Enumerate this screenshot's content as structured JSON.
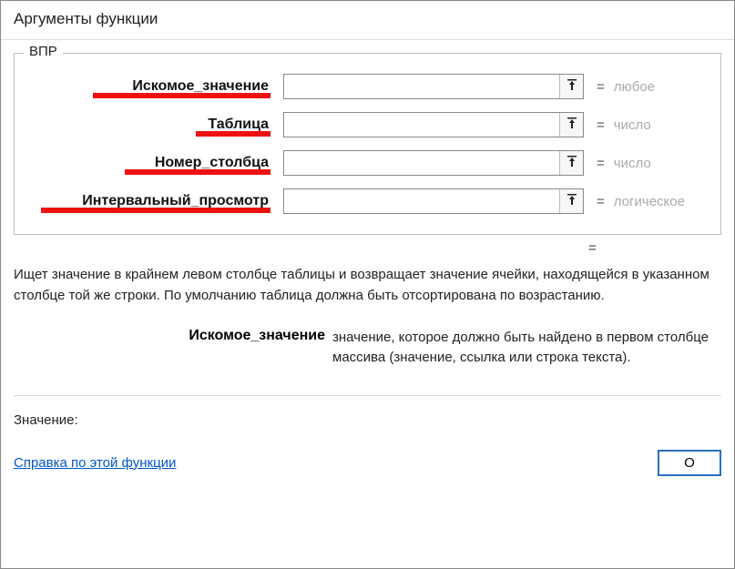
{
  "title": "Аргументы функции",
  "function_name": "ВПР",
  "args": [
    {
      "label": "Искомое_значение",
      "value": "",
      "type_hint": "любое",
      "underline_width": 195
    },
    {
      "label": "Таблица",
      "value": "",
      "type_hint": "число",
      "underline_width": 82
    },
    {
      "label": "Номер_столбца",
      "value": "",
      "type_hint": "число",
      "underline_width": 160
    },
    {
      "label": "Интервальный_просмотр",
      "value": "",
      "type_hint": "логическое",
      "underline_width": 252
    }
  ],
  "equals_sign": "=",
  "description": "Ищет значение в крайнем левом столбце таблицы и возвращает значение ячейки, находящейся в указанном столбце той же строки. По умолчанию таблица должна быть отсортирована по возрастанию.",
  "param_desc": {
    "name": "Искомое_значение",
    "text": "значение, которое должно быть найдено в первом столбце массива (значение, ссылка или строка текста)."
  },
  "result_label": "Значение:",
  "help_link": "Справка по этой функции",
  "ok_label": "О"
}
